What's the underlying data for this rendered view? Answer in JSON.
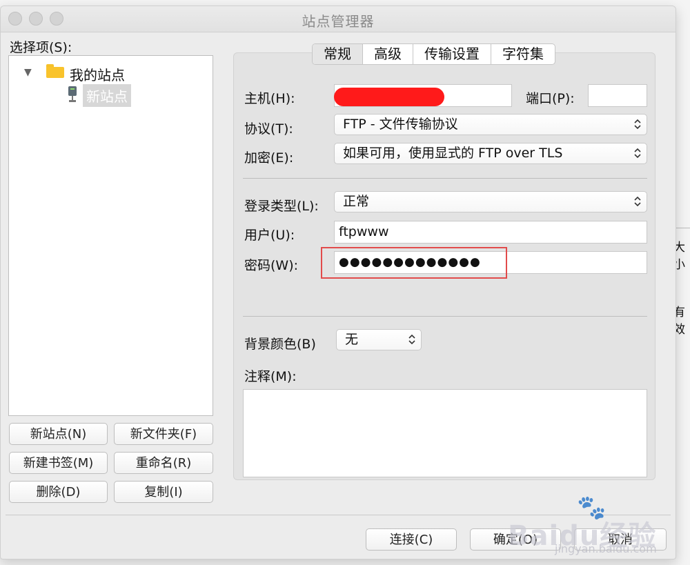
{
  "window": {
    "title": "站点管理器"
  },
  "background": {
    "right_text_1": "大小",
    "right_text_2": "有效"
  },
  "left": {
    "label": "选择项(S):",
    "tree": {
      "root": "我的站点",
      "child": "新站点"
    },
    "buttons": {
      "new_site": "新站点(N)",
      "new_folder": "新文件夹(F)",
      "new_bookmark": "新建书签(M)",
      "rename": "重命名(R)",
      "delete": "删除(D)",
      "copy": "复制(I)"
    }
  },
  "tabs": [
    "常规",
    "高级",
    "传输设置",
    "字符集"
  ],
  "general": {
    "host_label": "主机(H):",
    "host_value": "",
    "port_label": "端口(P):",
    "port_value": "",
    "protocol_label": "协议(T):",
    "protocol_value": "FTP - 文件传输协议",
    "encryption_label": "加密(E):",
    "encryption_value": "如果可用，使用显式的 FTP over TLS",
    "logon_type_label": "登录类型(L):",
    "logon_type_value": "正常",
    "user_label": "用户(U):",
    "user_value": "ftpwww",
    "password_label": "密码(W):",
    "password_value": "●●●●●●●●●●●●●",
    "bg_color_label": "背景颜色(B)",
    "bg_color_value": "无",
    "comments_label": "注释(M):"
  },
  "footer": {
    "connect": "连接(C)",
    "ok": "确定(O)",
    "cancel": "取消"
  },
  "watermark": {
    "text": "Baidu经验",
    "sub": "jingyan.baidu.com"
  },
  "colors": {
    "redaction": "#ff1a1a",
    "highlight": "#e24b4b",
    "folder": "#f9c32c"
  }
}
